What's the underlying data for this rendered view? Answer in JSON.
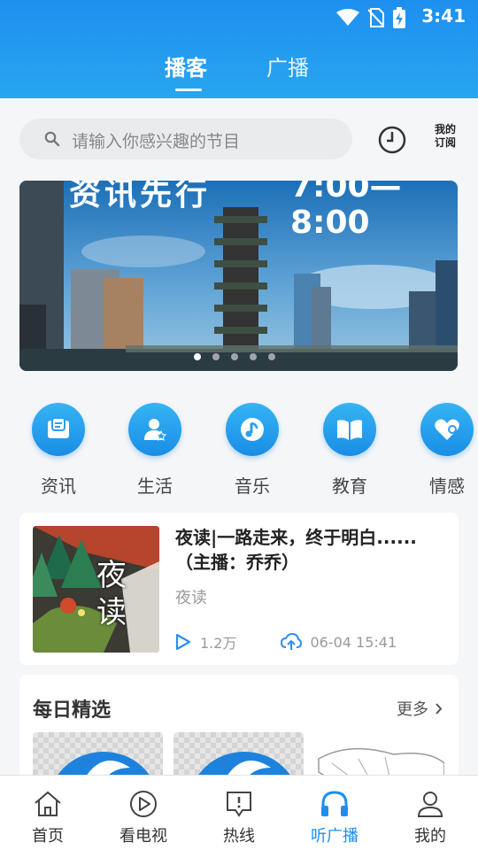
{
  "status_bar": {
    "time": "3:41"
  },
  "tabs": [
    {
      "label": "播客",
      "active": true
    },
    {
      "label": "广播",
      "active": false
    }
  ],
  "search": {
    "placeholder": "请输入你感兴趣的节目"
  },
  "subscribe_label_line1": "我的",
  "subscribe_label_line2": "订阅",
  "banner": {
    "headline": "资讯先行",
    "time_text": "7:00—8:00",
    "slide_count": 5,
    "active_slide": 0
  },
  "categories": [
    {
      "label": "资讯",
      "icon": "news-icon"
    },
    {
      "label": "生活",
      "icon": "life-icon"
    },
    {
      "label": "音乐",
      "icon": "music-icon"
    },
    {
      "label": "教育",
      "icon": "book-icon"
    },
    {
      "label": "情感",
      "icon": "heart-icon"
    }
  ],
  "featured": {
    "title": "夜读|一路走来，终于明白......（主播：乔乔）",
    "thumb_text": "夜读",
    "program": "夜读",
    "plays": "1.2万",
    "upload_time": "06-04 15:41"
  },
  "daily": {
    "title": "每日精选",
    "more": "更多"
  },
  "bottom_nav": [
    {
      "label": "首页",
      "icon": "home-icon",
      "active": false
    },
    {
      "label": "看电视",
      "icon": "tv-play-icon",
      "active": false
    },
    {
      "label": "热线",
      "icon": "hotline-icon",
      "active": false
    },
    {
      "label": "听广播",
      "icon": "headphones-icon",
      "active": true
    },
    {
      "label": "我的",
      "icon": "profile-icon",
      "active": false
    }
  ],
  "colors": {
    "primary": "#1d8ef0",
    "header_gradient_top": "#1e8ff0",
    "header_gradient_bottom": "#28a6ef"
  }
}
